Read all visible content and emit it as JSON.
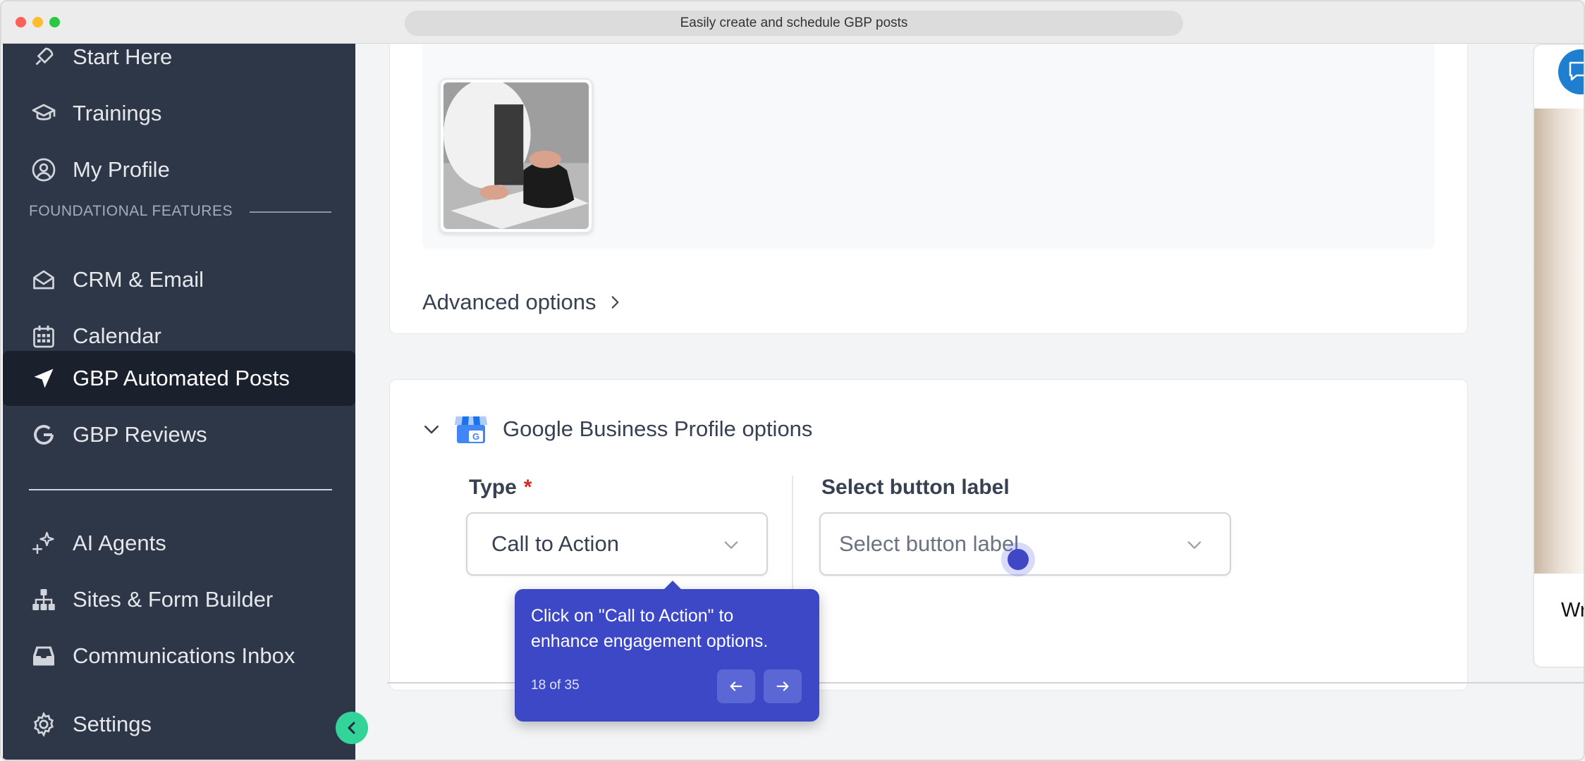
{
  "window": {
    "title": "Easily create and schedule GBP posts"
  },
  "sidebar": {
    "items": [
      {
        "label": "Start Here",
        "icon": "rocket-icon"
      },
      {
        "label": "Trainings",
        "icon": "graduation-cap-icon"
      },
      {
        "label": "My Profile",
        "icon": "user-circle-icon"
      },
      {
        "label": "CRM & Email",
        "icon": "envelope-open-icon"
      },
      {
        "label": "Calendar",
        "icon": "calendar-icon"
      },
      {
        "label": "GBP Automated Posts",
        "icon": "location-arrow-icon",
        "active": true
      },
      {
        "label": "GBP Reviews",
        "icon": "google-icon"
      },
      {
        "label": "AI Agents",
        "icon": "sparkles-icon"
      },
      {
        "label": "Sites & Form Builder",
        "icon": "sitemap-icon"
      },
      {
        "label": "Communications Inbox",
        "icon": "inbox-icon"
      },
      {
        "label": "Settings",
        "icon": "gear-icon"
      }
    ],
    "section_label": "FOUNDATIONAL FEATURES"
  },
  "post": {
    "advanced_options_label": "Advanced options"
  },
  "gbp_options": {
    "title": "Google Business Profile options",
    "type_label": "Type",
    "required_marker": "*",
    "type_value": "Call to Action",
    "button_label_title": "Select button label",
    "button_label_placeholder": "Select button label"
  },
  "preview": {
    "text": "Wr"
  },
  "tooltip": {
    "message": "Click on \"Call to Action\" to enhance engagement options.",
    "step": "18 of 35"
  },
  "colors": {
    "sidebar_bg": "#2d3748",
    "active_bg": "#1a202c",
    "tooltip_bg": "#3d48c6",
    "collapse_btn": "#34d399",
    "required": "#dc2626"
  }
}
